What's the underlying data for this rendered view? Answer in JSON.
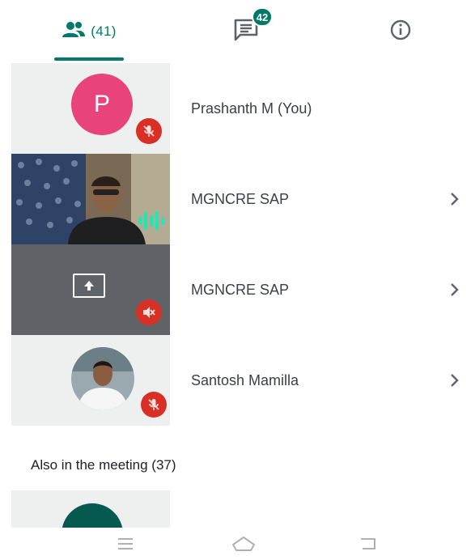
{
  "tabs": {
    "people": {
      "count_label": "(41)",
      "icon": "people-icon"
    },
    "chat": {
      "badge": "42",
      "icon": "chat-icon"
    },
    "info": {
      "icon": "info-icon"
    }
  },
  "participants": [
    {
      "avatar_letter": "P",
      "name": "Prashanth M (You)",
      "mic": "muted",
      "avatar_color": "#e8437a"
    },
    {
      "name": "MGNCRE SAP",
      "tile": "video",
      "audio": "speaking",
      "has_chevron": true
    },
    {
      "name": "MGNCRE SAP",
      "tile": "presentation",
      "audio": "presentation-muted",
      "has_chevron": true
    },
    {
      "name": "Santosh Mamilla",
      "tile": "photo",
      "mic": "muted",
      "has_chevron": true
    }
  ],
  "also_in_meeting": {
    "label": "Also in the meeting (37)"
  },
  "accent_color": "#00796b",
  "muted_color": "#d93025",
  "navigation": {
    "items": [
      "menu-icon",
      "home-icon",
      "back-icon"
    ]
  }
}
